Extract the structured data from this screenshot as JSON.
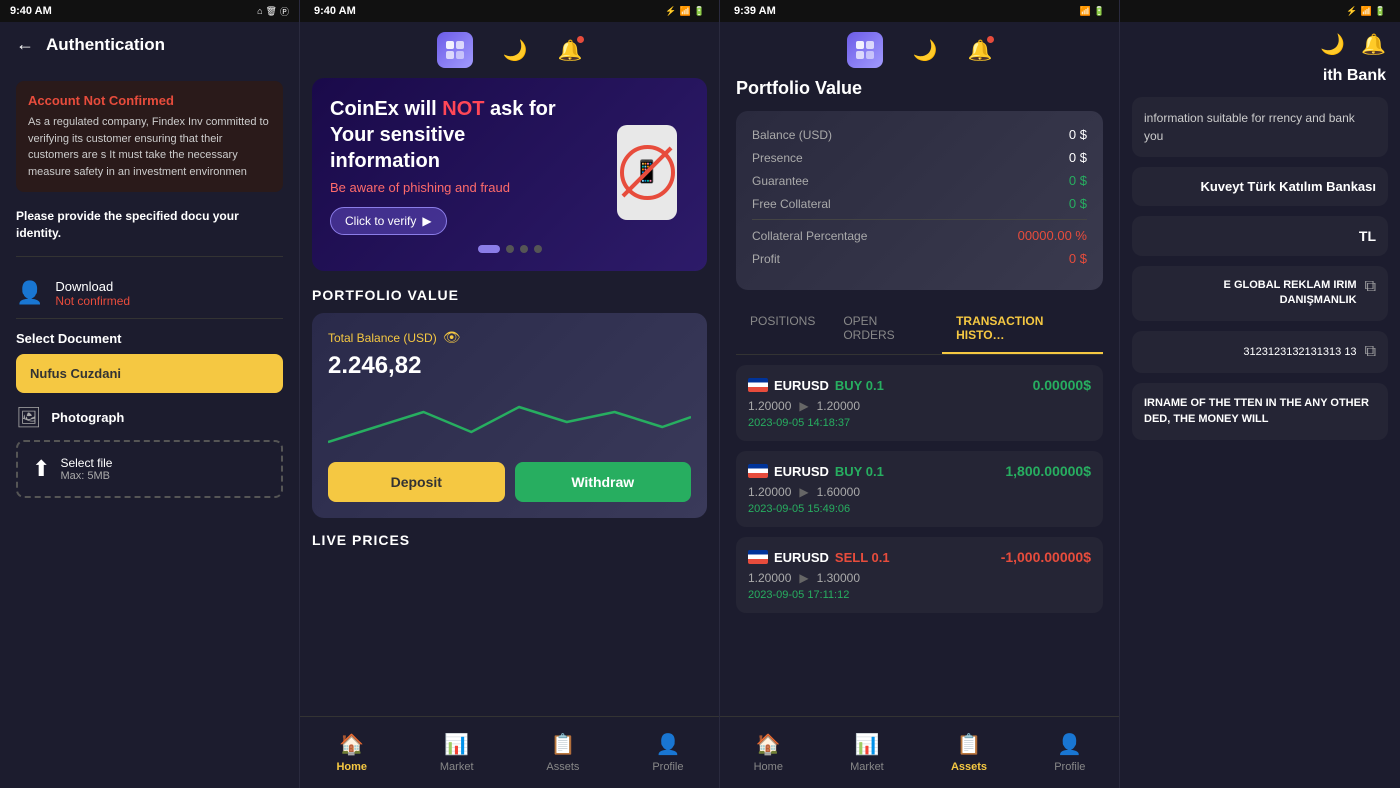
{
  "panel1": {
    "statusBar": {
      "time": "9:40 AM"
    },
    "title": "Authentication",
    "accountNotConfirmed": {
      "heading": "Account Not Confirmed",
      "text": "As a regulated company, Findex Inv committed to verifying its customer ensuring that their customers are s It must take the necessary measure safety in an investment environmen"
    },
    "provideDoc": "Please provide the specified docu your identity.",
    "download": {
      "label": "Download",
      "status": "Not confirmed"
    },
    "selectDocument": "Select Document",
    "nufusBtn": "Nufus Cuzdani",
    "photograph": {
      "label": "Photograph"
    },
    "fileUpload": {
      "label": "Select file",
      "maxSize": "Max: 5MB"
    }
  },
  "panel2": {
    "statusBar": {
      "time": "9:40 AM"
    },
    "banner": {
      "title": "CoinEx will NOT ask for Your sensitive information",
      "subtitle": "Be aware of phishing and fraud",
      "btnLabel": "Click to verify",
      "dots": [
        "active",
        "inactive",
        "inactive",
        "inactive"
      ]
    },
    "portfolioValue": {
      "sectionTitle": "PORTFOLIO VALUE",
      "totalBalanceLabel": "Total Balance (USD)",
      "amount": "2.246,82"
    },
    "depositBtn": "Deposit",
    "withdrawBtn": "Withdraw",
    "livePricesTitle": "LIVE PRICES",
    "nav": {
      "home": "Home",
      "market": "Market",
      "assets": "Assets",
      "profile": "Profile"
    }
  },
  "panel3": {
    "statusBar": {
      "time": "9:39 AM"
    },
    "title": "Portfolio Value",
    "balanceCard": {
      "balanceUSD": {
        "label": "Balance (USD)",
        "value": "0 $"
      },
      "presence": {
        "label": "Presence",
        "value": "0 $"
      },
      "guarantee": {
        "label": "Guarantee",
        "value": "0 $"
      },
      "freeCollateral": {
        "label": "Free Collateral",
        "value": "0 $"
      },
      "collateralPct": {
        "label": "Collateral Percentage",
        "value": "00000.00 %"
      },
      "profit": {
        "label": "Profit",
        "value": "0 $"
      }
    },
    "tabs": [
      "POSITIONS",
      "OPEN ORDERS",
      "TRANSACTION HISTORY"
    ],
    "activeTab": "TRANSACTION HISTORY",
    "transactions": [
      {
        "pair": "EURUSD",
        "action": "BUY",
        "size": "0.1",
        "priceFrom": "1.20000",
        "priceTo": "1.20000",
        "amount": "0.00000$",
        "date": "2023-09-05 14:18:37",
        "amountType": "neutral"
      },
      {
        "pair": "EURUSD",
        "action": "BUY",
        "size": "0.1",
        "priceFrom": "1.20000",
        "priceTo": "1.60000",
        "amount": "1,800.00000$",
        "date": "2023-09-05 15:49:06",
        "amountType": "positive"
      },
      {
        "pair": "EURUSD",
        "action": "SELL",
        "size": "0.1",
        "priceFrom": "1.20000",
        "priceTo": "1.30000",
        "amount": "-1,000.00000$",
        "date": "2023-09-05 17:11:12",
        "amountType": "negative"
      }
    ],
    "nav": {
      "home": "Home",
      "market": "Market",
      "assets": "Assets",
      "profile": "Profile"
    }
  },
  "panel4": {
    "statusBar": {
      "time": ""
    },
    "title": "ith Bank",
    "infoText": "information suitable for rrency and bank you",
    "bankName": "Kuveyt Türk Katılım Bankası",
    "currency": "TL",
    "adText": "E GLOBAL REKLAM IRIM DANIŞMANLIK",
    "accountNumber": "3123123132131313 13",
    "warningText": "IRNAME OF THE TTEN IN THE ANY OTHER DED, THE MONEY WILL"
  }
}
